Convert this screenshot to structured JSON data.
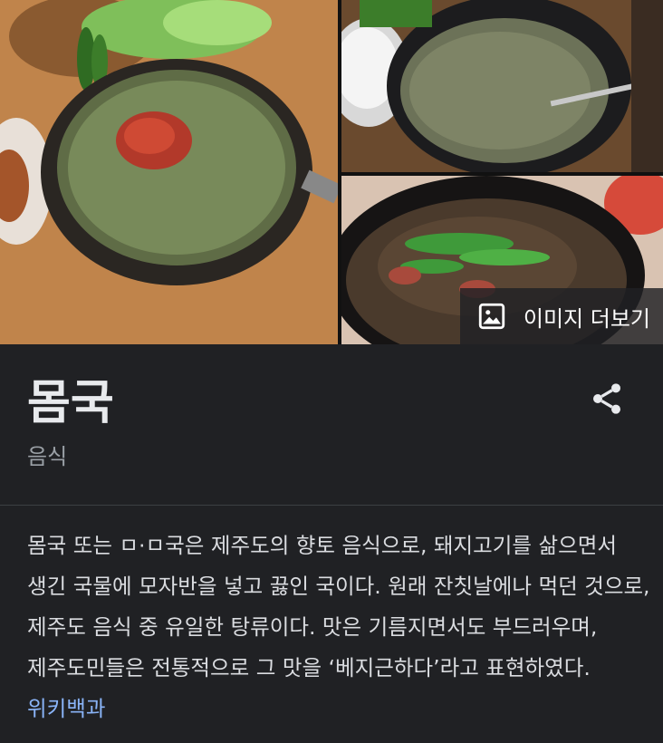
{
  "gallery": {
    "images": [
      {
        "subject": "momguk-bowl-with-chili"
      },
      {
        "subject": "momguk-with-rice"
      },
      {
        "subject": "momguk-with-green-onion"
      }
    ],
    "more_images_label": "이미지 더보기",
    "more_images_icon": "image-icon"
  },
  "entity": {
    "title": "몸국",
    "subtitle": "음식",
    "share_icon": "share-icon"
  },
  "description": {
    "text": "몸국 또는 ㅁ·ㅁ국은 제주도의 향토 음식으로, 돼지고기를 삶으면서 생긴 국물에 모자반을 넣고 끓인 국이다. 원래 잔칫날에나 먹던 것으로, 제주도 음식 중 유일한 탕류이다. 맛은 기름지면서도 부드러우며, 제주도민들은 전통적으로 그 맛을 ‘베지근하다’라고 표현하였다.",
    "source_link": "위키백과"
  },
  "colors": {
    "background": "#202124",
    "title": "#e8eaed",
    "subtitle": "#9aa0a6",
    "link": "#8ab4f8",
    "divider": "#3c4043"
  }
}
